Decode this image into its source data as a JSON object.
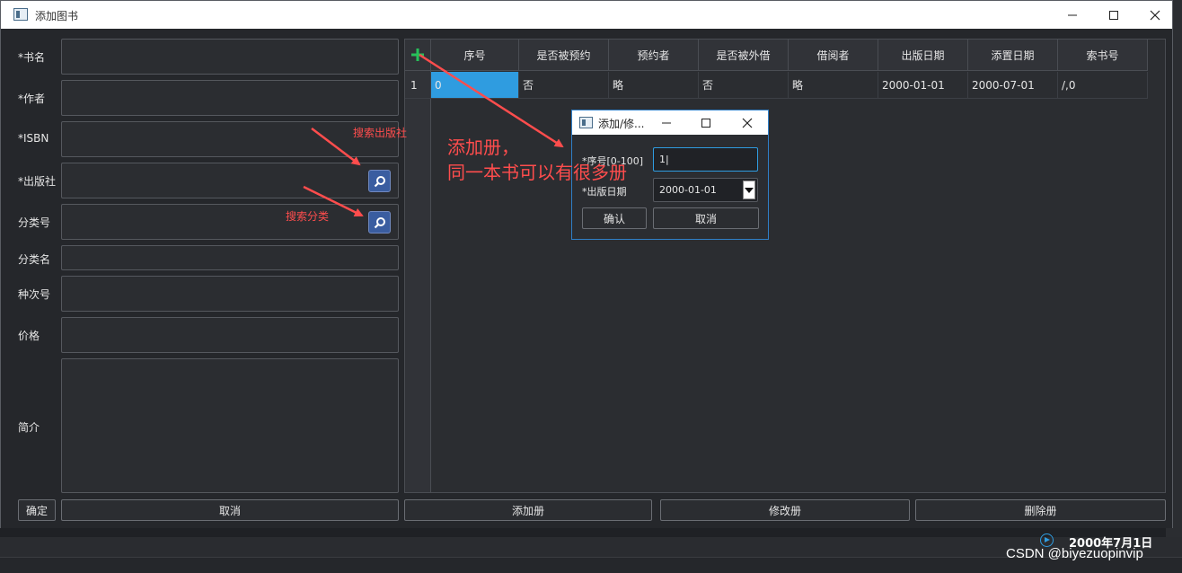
{
  "window": {
    "title": "添加图书"
  },
  "form": {
    "labels": {
      "name": "*书名",
      "author": "*作者",
      "isbn": "*ISBN",
      "publisher": "*出版社",
      "class_no": "分类号",
      "class_name": "分类名",
      "seq_no": "种次号",
      "price": "价格",
      "intro": "简介"
    },
    "buttons": {
      "ok": "确定",
      "cancel": "取消"
    }
  },
  "annotations": {
    "search_publisher": "搜索出版社",
    "search_class": "搜索分类",
    "add_copy": "添加册，",
    "add_copy_2": "同一本书可以有很多册"
  },
  "table": {
    "headers": [
      "序号",
      "是否被预约",
      "预约者",
      "是否被外借",
      "借阅者",
      "出版日期",
      "添置日期",
      "索书号"
    ],
    "rows": [
      {
        "row_no": "1",
        "cells": [
          "0",
          "否",
          "略",
          "否",
          "略",
          "2000-01-01",
          "2000-07-01",
          "/,0"
        ]
      }
    ],
    "buttons": {
      "add": "添加册",
      "edit": "修改册",
      "delete": "删除册"
    }
  },
  "dialog": {
    "title": "添加/修...",
    "seq_label": "*序号[0-100]",
    "seq_value": "1|",
    "date_label": "*出版日期",
    "date_value": "2000-01-01",
    "ok": "确认",
    "cancel": "取消"
  },
  "status": {
    "date": "2000年7月1日"
  },
  "watermark": "CSDN @biyezuopinvip",
  "colors": {
    "accent": "#2f9ce0",
    "annotation": "#ff4d4d",
    "search_button": "#3a5da0"
  }
}
